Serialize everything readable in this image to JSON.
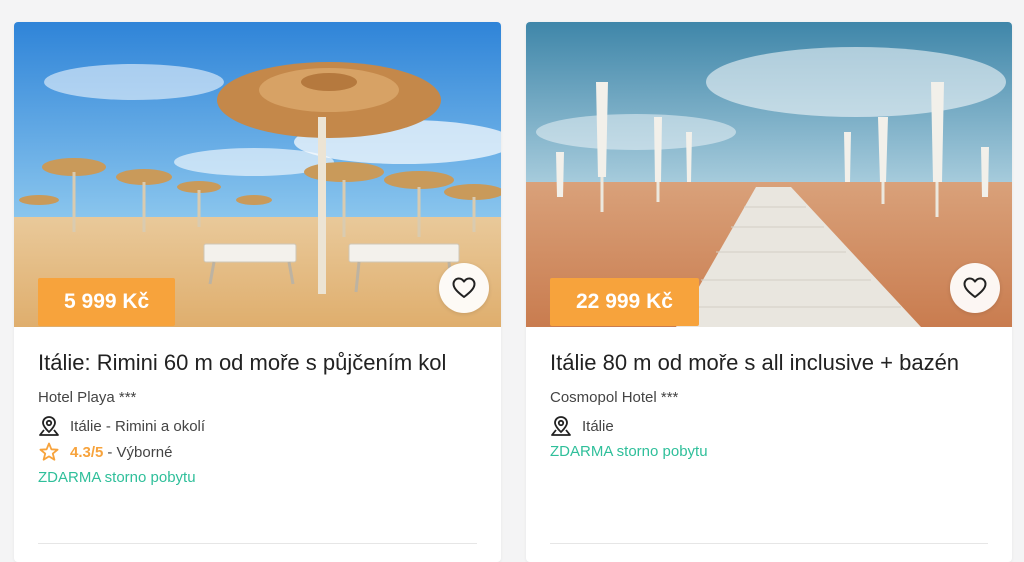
{
  "cards": [
    {
      "price": "5 999 Kč",
      "title": "Itálie: Rimini 60 m od moře s půjčením kol",
      "hotel": "Hotel Playa ***",
      "location": "Itálie - Rimini a okolí",
      "rating_value": "4.3/5",
      "rating_text": "- Výborné",
      "storno": "ZDARMA storno pobytu",
      "image": "beach-straw-umbrellas-photo"
    },
    {
      "price": "22 999 Kč",
      "title": "Itálie 80 m od moře s all inclusive + bazén",
      "hotel": "Cosmopol Hotel ***",
      "location": "Itálie",
      "storno": "ZDARMA storno pobytu",
      "image": "beach-boardwalk-closed-umbrellas-photo"
    }
  ],
  "icons": {
    "favorite": "heart-icon",
    "location": "map-pin-icon",
    "rating": "star-icon"
  },
  "colors": {
    "price_badge": "#f7a33c",
    "storno": "#2fbf9a",
    "rating": "#f7a33c"
  }
}
